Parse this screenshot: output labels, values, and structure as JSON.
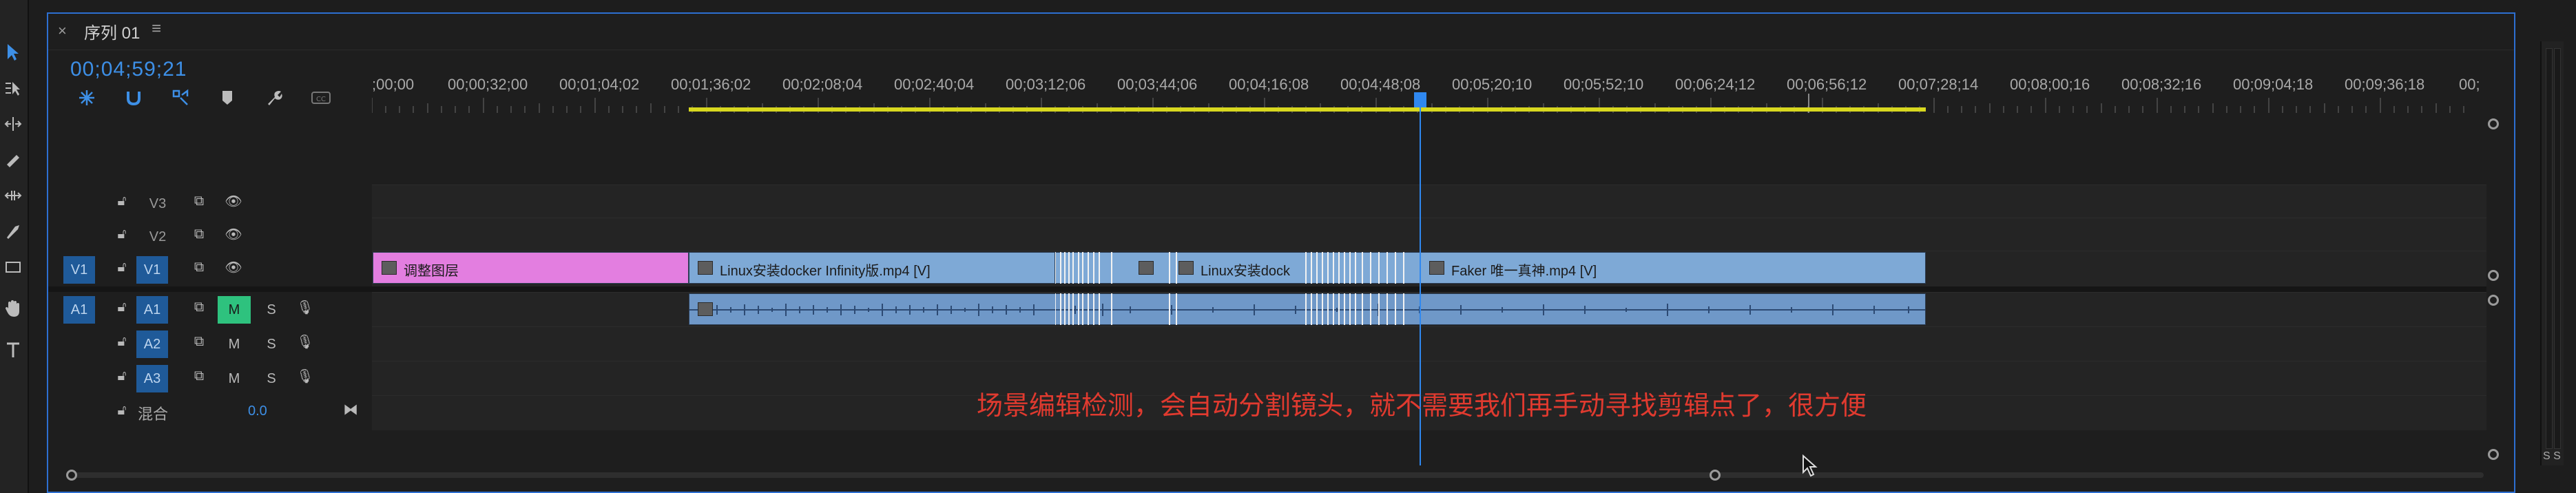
{
  "tab": {
    "close": "×",
    "title": "序列 01",
    "menu": "≡"
  },
  "timecode": "00;04;59;21",
  "ruler": {
    "labels": [
      ";00;00",
      "00;00;32;00",
      "00;01;04;02",
      "00;01;36;02",
      "00;02;08;04",
      "00;02;40;04",
      "00;03;12;06",
      "00;03;44;06",
      "00;04;16;08",
      "00;04;48;08",
      "00;05;20;10",
      "00;05;52;10",
      "00;06;24;12",
      "00;06;56;12",
      "00;07;28;14",
      "00;08;00;16",
      "00;08;32;16",
      "00;09;04;18",
      "00;09;36;18",
      "00;"
    ]
  },
  "tracks": {
    "v3": {
      "label": "V3"
    },
    "v2": {
      "label": "V2"
    },
    "v1": {
      "source": "V1",
      "label": "V1"
    },
    "a1": {
      "source": "A1",
      "label": "A1",
      "m": "M",
      "s": "S"
    },
    "a2": {
      "label": "A2",
      "m": "M",
      "s": "S"
    },
    "a3": {
      "label": "A3",
      "m": "M",
      "s": "S"
    },
    "mix": {
      "label": "混合",
      "value": "0.0"
    }
  },
  "clips": {
    "adjust": "调整图层",
    "linux1": "Linux安装docker Infinity版.mp4 [V]",
    "linux2": "Linux安装dock",
    "faker": "Faker 唯一真神.mp4 [V]"
  },
  "subtitle": "场景编辑检测，会自动分割镜头，就不需要我们再手动寻找剪辑点了，很方便",
  "meter": {
    "labels": "S S"
  },
  "colors": {
    "accent": "#2f88f0",
    "video_clip": "#7ea9d6",
    "adjustment_clip": "#e37ee0",
    "audio_clip": "#6f98c8",
    "work_area": "#d8d81f",
    "subtitle": "#e03a2f",
    "mute_on": "#2ec27e"
  }
}
